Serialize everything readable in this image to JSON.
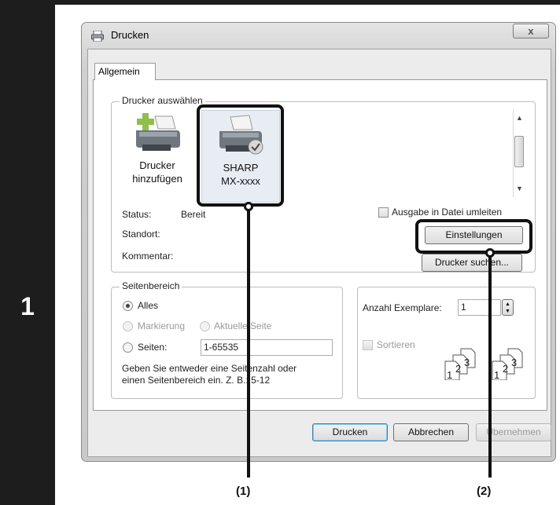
{
  "step_number": "1",
  "dialog": {
    "title": "Drucken",
    "close_glyph": "x",
    "tab_label": "Allgemein",
    "printer_group": {
      "legend": "Drucker auswählen",
      "items": [
        {
          "line1": "Drucker",
          "line2": "hinzufügen",
          "icon": "add-printer-icon"
        },
        {
          "line1": "SHARP",
          "line2": "MX-xxxx",
          "icon": "printer-icon"
        }
      ],
      "status_label": "Status:",
      "status_value": "Bereit",
      "location_label": "Standort:",
      "comment_label": "Kommentar:",
      "print_to_file_label": "Ausgabe in Datei umleiten",
      "settings_button": "Einstellungen",
      "find_printer_button": "Drucker suchen..."
    },
    "page_range": {
      "legend": "Seitenbereich",
      "all_label": "Alles",
      "selection_label": "Markierung",
      "current_page_label": "Aktuelle Seite",
      "pages_label": "Seiten:",
      "pages_value": "1-65535",
      "hint_line1": "Geben Sie entweder eine Seitenzahl oder",
      "hint_line2": "einen Seitenbereich ein. Z. B.: 5-12"
    },
    "copies": {
      "label": "Anzahl Exemplare:",
      "value": "1",
      "collate_label": "Sortieren",
      "collate_pages": [
        "1",
        "2",
        "3"
      ]
    },
    "buttons": {
      "print": "Drucken",
      "cancel": "Abbrechen",
      "apply": "Übernehmen"
    }
  },
  "callouts": [
    "(1)",
    "(2)"
  ],
  "colors": {
    "step_bar": "#1d1d1d",
    "highlight": "#111111"
  }
}
